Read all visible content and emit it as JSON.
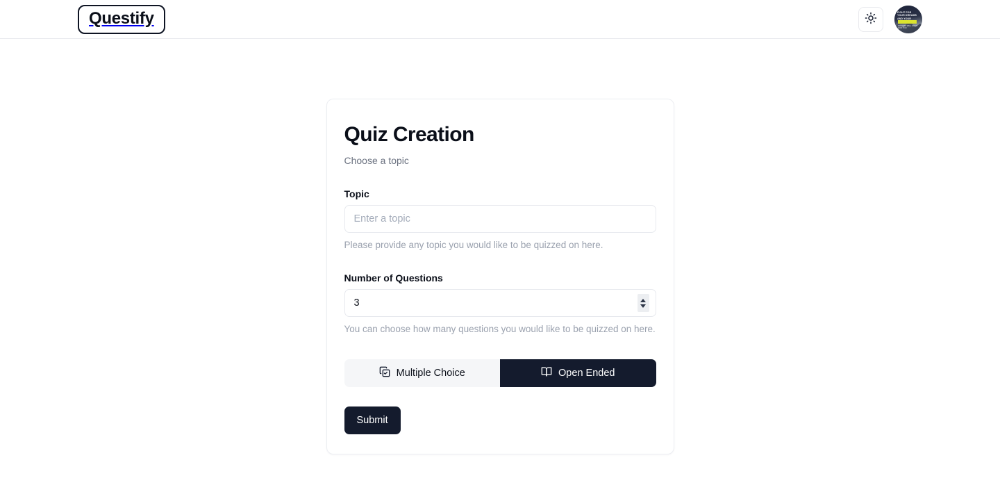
{
  "header": {
    "brand": "Questify",
    "theme_toggle_icon": "sun-icon",
    "avatar_icon": "user-avatar",
    "avatar_text_line1": "Fight for",
    "avatar_text_line2": "your dreams",
    "avatar_text_line3": "and your",
    "avatar_caption": "dreams will fight for you"
  },
  "card": {
    "title": "Quiz Creation",
    "subtitle": "Choose a topic",
    "topic": {
      "label": "Topic",
      "placeholder": "Enter a topic",
      "value": "",
      "helper": "Please provide any topic you would like to be quizzed on here."
    },
    "questions": {
      "label": "Number of Questions",
      "value": "3",
      "placeholder": "3",
      "helper": "You can choose how many questions you would like to be quizzed on here."
    },
    "modes": {
      "multiple_choice_label": "Multiple Choice",
      "multiple_choice_icon": "copy-check-icon",
      "open_ended_label": "Open Ended",
      "open_ended_icon": "book-open-icon",
      "selected": "Open Ended"
    },
    "submit_label": "Submit"
  },
  "colors": {
    "accent_dark": "#141b2d",
    "inactive_bg": "#f5f6f8",
    "border": "#e7e9ee",
    "muted_text": "#9aa1ae",
    "avatar_highlight": "#dbe32e"
  }
}
